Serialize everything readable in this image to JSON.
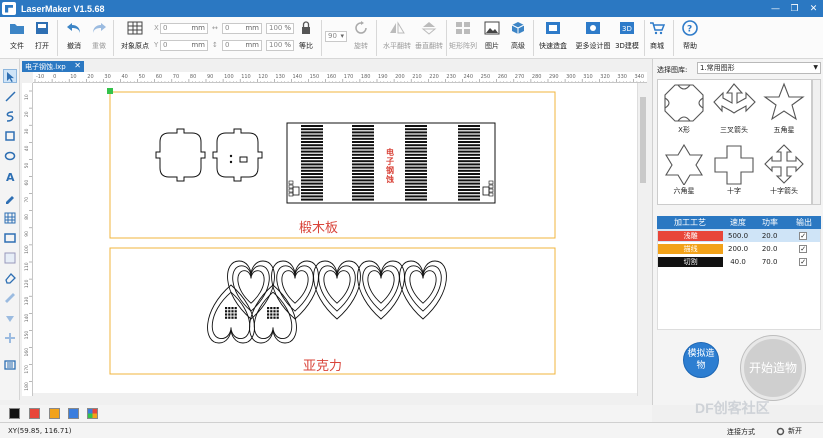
{
  "window": {
    "title": "LaserMaker V1.5.68",
    "minimize": "—",
    "restore": "❐",
    "close": "✕"
  },
  "toolbar": {
    "file": "文件",
    "open": "打开",
    "undo": "撤消",
    "redo": "重做",
    "align": "对象原点",
    "x_value": "0",
    "y_value": "0",
    "w_value": "0",
    "h_value": "0",
    "w_pct": "100",
    "h_pct": "100",
    "unit_mm": "mm",
    "unit_pct": "%",
    "lock_ratio": "等比",
    "rotate_value": "90",
    "rotate": "旋转",
    "flip_h": "水平翻转",
    "flip_v": "垂直翻转",
    "array": "矩形阵列",
    "image": "图片",
    "advanced": "高级",
    "quick_process": "快速造盒",
    "more_design": "更多设计图",
    "model3d": "3D建模",
    "shop": "商城",
    "help": "帮助"
  },
  "document": {
    "tab_label": "电子钢蚀.lxp",
    "close": "✕"
  },
  "ruler": {
    "h_ticks": [
      "-10",
      "0",
      "10",
      "20",
      "30",
      "40",
      "50",
      "60",
      "70",
      "80",
      "90",
      "100",
      "110",
      "120",
      "130",
      "140",
      "150",
      "160",
      "170",
      "180",
      "190",
      "200",
      "210",
      "220",
      "230",
      "240",
      "250",
      "260",
      "270",
      "280",
      "290",
      "300",
      "310",
      "320",
      "330",
      "340"
    ],
    "v_ticks": [
      "10",
      "20",
      "30",
      "40",
      "50",
      "60",
      "70",
      "80",
      "90",
      "100",
      "110",
      "120",
      "130",
      "140",
      "150",
      "160",
      "170",
      "180"
    ]
  },
  "canvas": {
    "board1_label": "椴木板",
    "board2_label": "亚克力",
    "engrave_text": "电子钢蚀"
  },
  "library": {
    "label": "选择图库:",
    "selected": "1.常用图形",
    "shapes": [
      {
        "name": "X形"
      },
      {
        "name": "三叉箭头"
      },
      {
        "name": "五角星"
      },
      {
        "name": "六角星"
      },
      {
        "name": "十字"
      },
      {
        "name": "十字箭头"
      }
    ]
  },
  "process_table": {
    "headers": [
      "加工工艺",
      "速度",
      "功率",
      "输出"
    ],
    "rows": [
      {
        "name": "浅雕",
        "speed": "500.0",
        "power": "20.0",
        "output": "✓",
        "color": "#e8463a"
      },
      {
        "name": "描线",
        "speed": "200.0",
        "power": "20.0",
        "output": "✓",
        "color": "#f2a21a"
      },
      {
        "name": "切割",
        "speed": "40.0",
        "power": "70.0",
        "output": "✓",
        "color": "#111111"
      }
    ]
  },
  "actions": {
    "simulate": "模拟造物",
    "start": "开始造物"
  },
  "palette": [
    "#111111",
    "#e8463a",
    "#f2a21a",
    "#3b7ddd"
  ],
  "status": {
    "coordinates": "XY(59.85, 116.71)",
    "connect_mode": "连接方式",
    "new": "新开"
  },
  "watermark": "DF创客社区",
  "colors": {
    "accent": "#2b78c2",
    "canvas_frame": "#f0b43c",
    "label_red": "#d9443a"
  }
}
